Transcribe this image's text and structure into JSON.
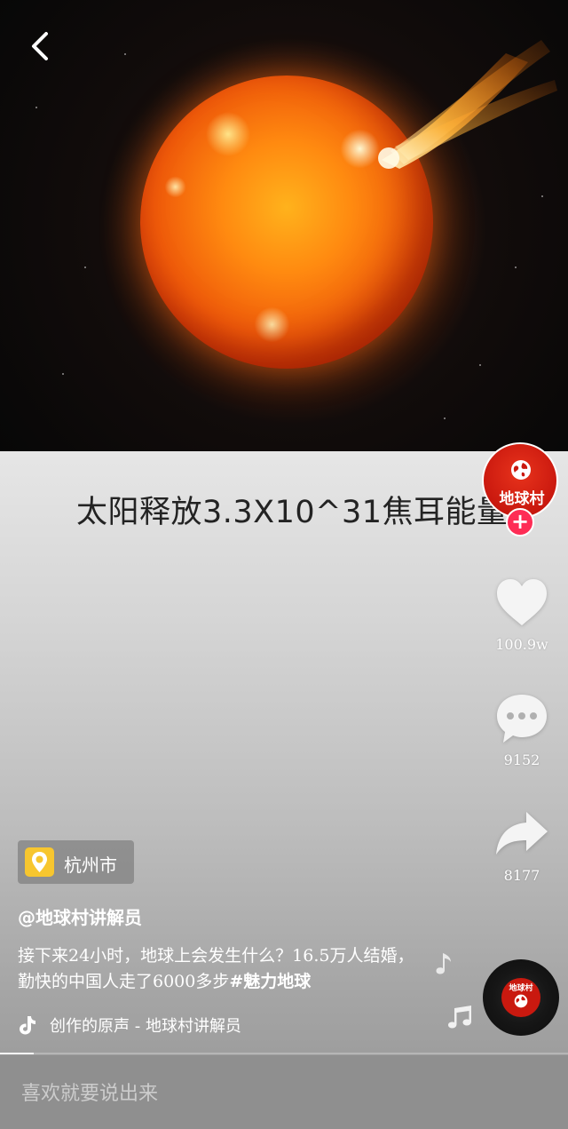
{
  "video": {
    "overlay_caption": "太阳释放3.3X10^31焦耳能量"
  },
  "nav": {
    "back_icon": "chevron-left-icon"
  },
  "creator": {
    "avatar_label": "地球村",
    "avatar_icon": "globe-icon",
    "follow_label": "+"
  },
  "actions": {
    "like_count": "100.9w",
    "comment_count": "9152",
    "share_count": "8177"
  },
  "location": {
    "label": "杭州市",
    "icon": "location-pin-icon"
  },
  "post": {
    "author": "@地球村讲解员",
    "description": "接下来24小时，地球上会发生什么？16.5万人结婚，勤快的中国人走了6000多步",
    "hashtag": "#魅力地球"
  },
  "music": {
    "label": "创作的原声 - 地球村讲解员",
    "icon": "tiktok-note-icon",
    "disc_label": "地球村"
  },
  "playback": {
    "progress_fraction": 0.06
  },
  "comment": {
    "placeholder": "喜欢就要说出来"
  },
  "colors": {
    "accent": "#fe2c55",
    "avatar_red": "#c9180e",
    "location_yellow": "#f7c62f"
  }
}
